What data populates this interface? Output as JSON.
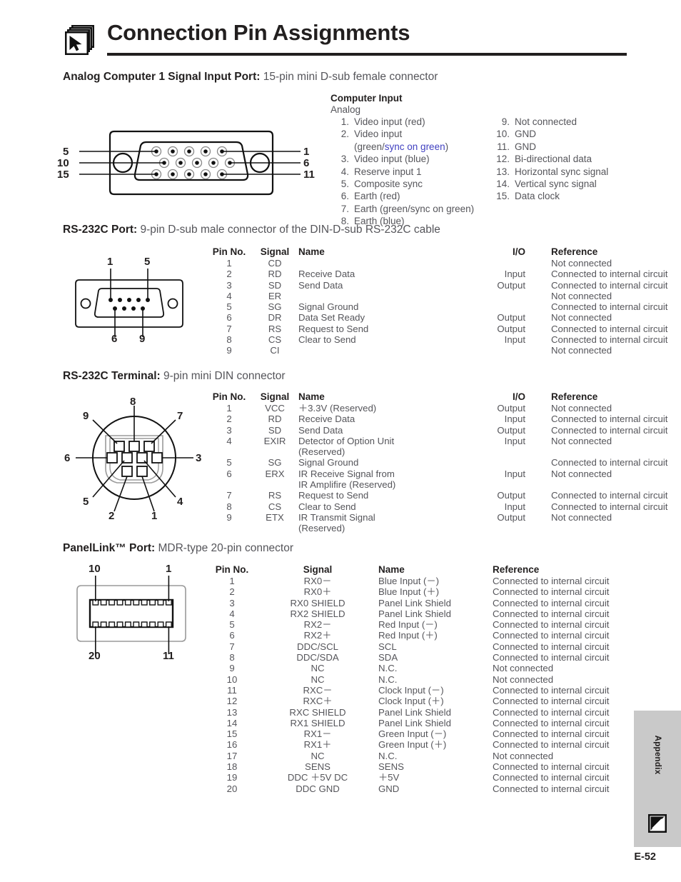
{
  "header": {
    "title": "Connection Pin Assignments",
    "icon": "pages-cursor-icon"
  },
  "sections": {
    "analog": {
      "heading_bold": "Analog Computer 1 Signal Input Port:",
      "heading_rest": " 15-pin mini D-sub female connector",
      "connector_labels": {
        "left": [
          "5",
          "10",
          "15"
        ],
        "right": [
          "1",
          "6",
          "11"
        ]
      },
      "block_title": "Computer Input",
      "block_subtitle": "Analog",
      "pins_left": [
        {
          "num": "1.",
          "text": "Video input (red)"
        },
        {
          "num": "2.",
          "text": "Video input"
        },
        {
          "num": "",
          "text_pre": "(green/",
          "text_link": "sync on green",
          "text_post": ")"
        },
        {
          "num": "3.",
          "text": "Video input (blue)"
        },
        {
          "num": "4.",
          "text": "Reserve input 1"
        },
        {
          "num": "5.",
          "text": "Composite sync"
        },
        {
          "num": "6.",
          "text": "Earth (red)"
        },
        {
          "num": "7.",
          "text": "Earth (green/sync on green)"
        },
        {
          "num": "8.",
          "text": "Earth (blue)"
        }
      ],
      "pins_right": [
        {
          "num": "9.",
          "text": "Not connected"
        },
        {
          "num": "10.",
          "text": "GND"
        },
        {
          "num": "11.",
          "text": "GND"
        },
        {
          "num": "12.",
          "text": "Bi-directional data"
        },
        {
          "num": "13.",
          "text": "Horizontal sync signal"
        },
        {
          "num": "14.",
          "text": "Vertical sync signal"
        },
        {
          "num": "15.",
          "text": "Data clock"
        }
      ]
    },
    "rs232c_port": {
      "heading_bold": "RS-232C Port:",
      "heading_rest": " 9-pin D-sub male connector of the DIN-D-sub RS-232C cable",
      "connector_labels": {
        "top": [
          "1",
          "5"
        ],
        "bottom": [
          "6",
          "9"
        ]
      },
      "columns": [
        "Pin No.",
        "Signal",
        "Name",
        "I/O",
        "Reference"
      ],
      "rows": [
        {
          "pin": "1",
          "signal": "CD",
          "name": "",
          "io": "",
          "reference": "Not connected"
        },
        {
          "pin": "2",
          "signal": "RD",
          "name": "Receive Data",
          "io": "Input",
          "reference": "Connected to internal circuit"
        },
        {
          "pin": "3",
          "signal": "SD",
          "name": "Send Data",
          "io": "Output",
          "reference": "Connected to internal circuit"
        },
        {
          "pin": "4",
          "signal": "ER",
          "name": "",
          "io": "",
          "reference": "Not connected"
        },
        {
          "pin": "5",
          "signal": "SG",
          "name": "Signal Ground",
          "io": "",
          "reference": "Connected to internal circuit"
        },
        {
          "pin": "6",
          "signal": "DR",
          "name": "Data Set Ready",
          "io": "Output",
          "reference": "Not connected"
        },
        {
          "pin": "7",
          "signal": "RS",
          "name": "Request to Send",
          "io": "Output",
          "reference": "Connected to internal circuit"
        },
        {
          "pin": "8",
          "signal": "CS",
          "name": "Clear to Send",
          "io": "Input",
          "reference": "Connected to internal circuit"
        },
        {
          "pin": "9",
          "signal": "CI",
          "name": "",
          "io": "",
          "reference": "Not connected"
        }
      ]
    },
    "rs232c_terminal": {
      "heading_bold": "RS-232C Terminal:",
      "heading_rest": " 9-pin mini DIN connector",
      "connector_labels": {
        "top": "8",
        "upper_left": "9",
        "upper_right": "7",
        "left": "6",
        "right": "3",
        "lower_left": "5",
        "lower_right": "4",
        "bottom_left": "2",
        "bottom_right": "1"
      },
      "columns": [
        "Pin No.",
        "Signal",
        "Name",
        "I/O",
        "Reference"
      ],
      "rows": [
        {
          "pin": "1",
          "signal": "VCC",
          "name": "＋3.3V (Reserved)",
          "name2": "",
          "io": "Output",
          "reference": "Not connected"
        },
        {
          "pin": "2",
          "signal": "RD",
          "name": "Receive Data",
          "name2": "",
          "io": "Input",
          "reference": "Connected to internal circuit"
        },
        {
          "pin": "3",
          "signal": "SD",
          "name": "Send Data",
          "name2": "",
          "io": "Output",
          "reference": "Connected to internal circuit"
        },
        {
          "pin": "4",
          "signal": "EXIR",
          "name": "Detector of Option Unit",
          "name2": "(Reserved)",
          "io": "Input",
          "reference": "Not connected"
        },
        {
          "pin": "5",
          "signal": "SG",
          "name": "Signal Ground",
          "name2": "",
          "io": "",
          "reference": "Connected to internal circuit"
        },
        {
          "pin": "6",
          "signal": "ERX",
          "name": "IR Receive Signal from",
          "name2": "IR Amplifire (Reserved)",
          "io": "Input",
          "reference": "Not connected"
        },
        {
          "pin": "7",
          "signal": "RS",
          "name": "Request to Send",
          "name2": "",
          "io": "Output",
          "reference": "Connected to internal circuit"
        },
        {
          "pin": "8",
          "signal": "CS",
          "name": "Clear to Send",
          "name2": "",
          "io": "Input",
          "reference": "Connected to internal circuit"
        },
        {
          "pin": "9",
          "signal": "ETX",
          "name": "IR Transmit Signal",
          "name2": "(Reserved)",
          "io": "Output",
          "reference": "Not connected"
        }
      ]
    },
    "panellink": {
      "heading_bold": "PanelLink™ Port:",
      "heading_rest": " MDR-type 20-pin connector",
      "connector_labels": {
        "top_left": "10",
        "top_right": "1",
        "bottom_left": "20",
        "bottom_right": "11"
      },
      "columns": [
        "Pin No.",
        "Signal",
        "Name",
        "Reference"
      ],
      "rows": [
        {
          "pin": "1",
          "signal": "RX0－",
          "name": "Blue Input (－)",
          "reference": "Connected to internal circuit"
        },
        {
          "pin": "2",
          "signal": "RX0＋",
          "name": "Blue Input (＋)",
          "reference": "Connected to internal circuit"
        },
        {
          "pin": "3",
          "signal": "RX0 SHIELD",
          "name": "Panel Link Shield",
          "reference": "Connected to internal circuit"
        },
        {
          "pin": "4",
          "signal": "RX2 SHIELD",
          "name": "Panel Link Shield",
          "reference": "Connected to internal circuit"
        },
        {
          "pin": "5",
          "signal": "RX2－",
          "name": "Red Input (－)",
          "reference": "Connected to internal circuit"
        },
        {
          "pin": "6",
          "signal": "RX2＋",
          "name": "Red Input (＋)",
          "reference": "Connected to internal circuit"
        },
        {
          "pin": "7",
          "signal": "DDC/SCL",
          "name": "SCL",
          "reference": "Connected to internal circuit"
        },
        {
          "pin": "8",
          "signal": "DDC/SDA",
          "name": "SDA",
          "reference": "Connected to internal circuit"
        },
        {
          "pin": "9",
          "signal": "NC",
          "name": "N.C.",
          "reference": "Not connected"
        },
        {
          "pin": "10",
          "signal": "NC",
          "name": "N.C.",
          "reference": "Not connected"
        },
        {
          "pin": "11",
          "signal": "RXC－",
          "name": "Clock Input (－)",
          "reference": "Connected to internal circuit"
        },
        {
          "pin": "12",
          "signal": "RXC＋",
          "name": "Clock Input (＋)",
          "reference": "Connected to internal circuit"
        },
        {
          "pin": "13",
          "signal": "RXC SHIELD",
          "name": "Panel Link Shield",
          "reference": "Connected to internal circuit"
        },
        {
          "pin": "14",
          "signal": "RX1 SHIELD",
          "name": "Panel Link Shield",
          "reference": "Connected to internal circuit"
        },
        {
          "pin": "15",
          "signal": "RX1－",
          "name": "Green Input (－)",
          "reference": "Connected to internal circuit"
        },
        {
          "pin": "16",
          "signal": "RX1＋",
          "name": "Green Input (＋)",
          "reference": "Connected to internal circuit"
        },
        {
          "pin": "17",
          "signal": "NC",
          "name": "N.C.",
          "reference": "Not connected"
        },
        {
          "pin": "18",
          "signal": "SENS",
          "name": "SENS",
          "reference": "Connected to internal circuit"
        },
        {
          "pin": "19",
          "signal": "DDC ＋5V DC",
          "name": "＋5V",
          "reference": "Connected to internal circuit"
        },
        {
          "pin": "20",
          "signal": "DDC GND",
          "name": "GND",
          "reference": "Connected to internal circuit"
        }
      ]
    }
  },
  "sidebar": {
    "label": "Appendix",
    "icon": "page-arrow-icon"
  },
  "footer": {
    "page_number": "E-52"
  },
  "colors": {
    "text": "#55555a",
    "heading": "#221f1f",
    "link": "#4040c0",
    "sidebar_bg": "#c9c9c9"
  }
}
